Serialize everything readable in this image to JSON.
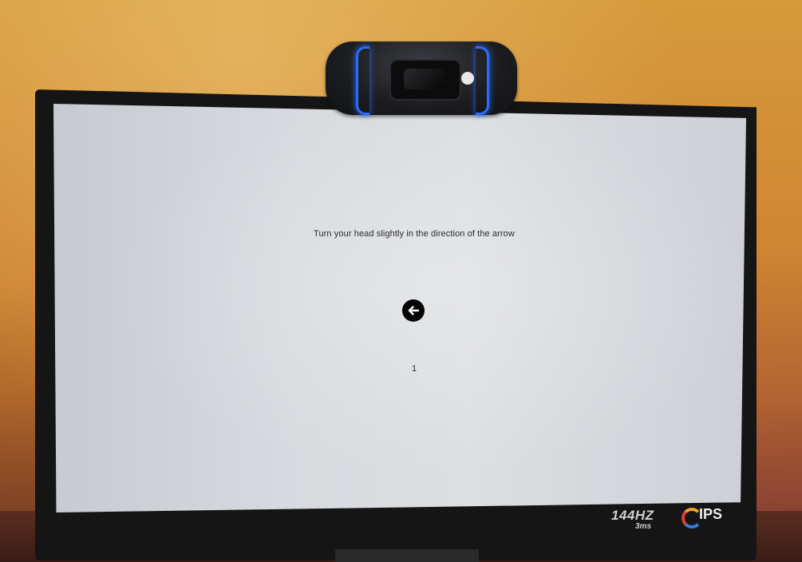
{
  "scene": {
    "wall_color": "#d28a34",
    "monitor_color": "#151515",
    "screen_color": "#d7dade",
    "webcam_ring_color": "#2a6cff",
    "arrow_color": "#050505"
  },
  "screen": {
    "instruction": "Turn your head slightly in the direction of the arrow",
    "arrow_icon": "arrow-left-icon",
    "counter": "1"
  },
  "monitor_badges": {
    "refresh_rate": "144HZ",
    "response_time": "3ms",
    "panel": "IPS"
  }
}
